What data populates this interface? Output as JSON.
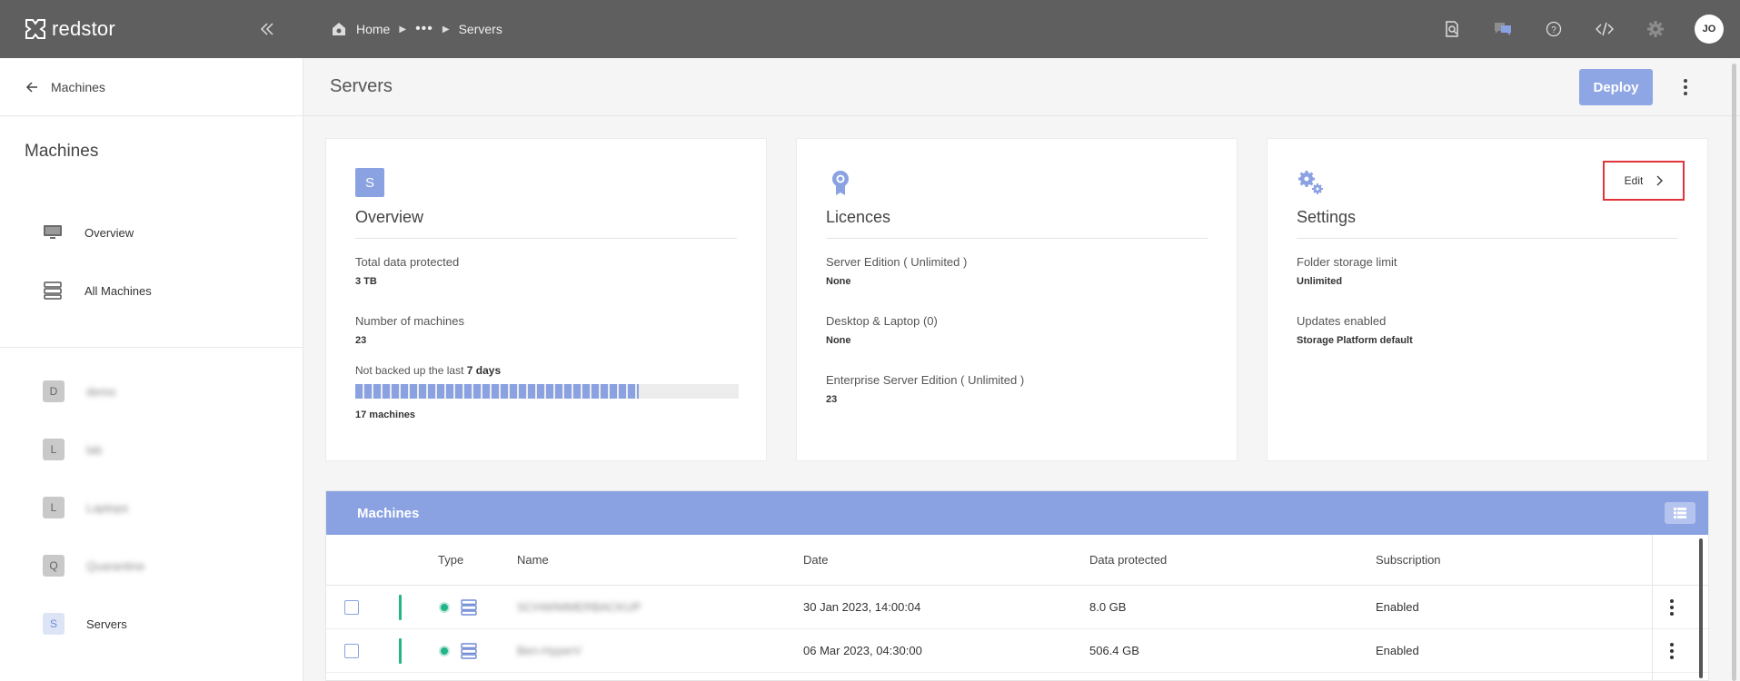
{
  "brand": {
    "name": "redstor"
  },
  "breadcrumb": {
    "home": "Home",
    "dots": "•••",
    "current": "Servers"
  },
  "user": {
    "initials": "JO"
  },
  "sidebar": {
    "back_label": "Machines",
    "title": "Machines",
    "nav": [
      {
        "label": "Overview",
        "icon": "monitor-icon"
      },
      {
        "label": "All Machines",
        "icon": "server-stack-icon"
      }
    ],
    "groups": [
      {
        "badge": "D",
        "label": "demo"
      },
      {
        "badge": "L",
        "label": "lab"
      },
      {
        "badge": "L",
        "label": "Laptops"
      },
      {
        "badge": "Q",
        "label": "Quarantine"
      },
      {
        "badge": "S",
        "label": "Servers"
      }
    ]
  },
  "page": {
    "title": "Servers",
    "deploy_label": "Deploy"
  },
  "overview": {
    "badge": "S",
    "title": "Overview",
    "total_label": "Total data protected",
    "total_value": "3 TB",
    "count_label": "Number of machines",
    "count_value": "23",
    "not_backed_prefix": "Not backed up the last",
    "not_backed_days": "7 days",
    "not_backed_fraction": 0.74,
    "not_backed_count": "17 machines"
  },
  "licences": {
    "title": "Licences",
    "items": [
      {
        "label": "Server Edition ( Unlimited )",
        "value": "None"
      },
      {
        "label": "Desktop & Laptop (0)",
        "value": "None"
      },
      {
        "label": "Enterprise Server Edition ( Unlimited )",
        "value": "23"
      }
    ]
  },
  "settings": {
    "title": "Settings",
    "edit_label": "Edit",
    "items": [
      {
        "label": "Folder storage limit",
        "value": "Unlimited"
      },
      {
        "label": "Updates enabled",
        "value": "Storage Platform default"
      }
    ]
  },
  "machines": {
    "title": "Machines",
    "columns": {
      "type": "Type",
      "name": "Name",
      "date": "Date",
      "data": "Data protected",
      "subscription": "Subscription"
    },
    "rows": [
      {
        "name": "SCHWIMMERBACKUP",
        "date": "30 Jan 2023, 14:00:04",
        "data": "8.0 GB",
        "subscription": "Enabled"
      },
      {
        "name": "Ben-HyperV",
        "date": "06 Mar 2023, 04:30:00",
        "data": "506.4 GB",
        "subscription": "Enabled"
      }
    ]
  },
  "colors": {
    "accent": "#8aa2e2",
    "topbar": "#5f5f5f",
    "status_ok": "#24b48a",
    "highlight": "#e0353a"
  }
}
